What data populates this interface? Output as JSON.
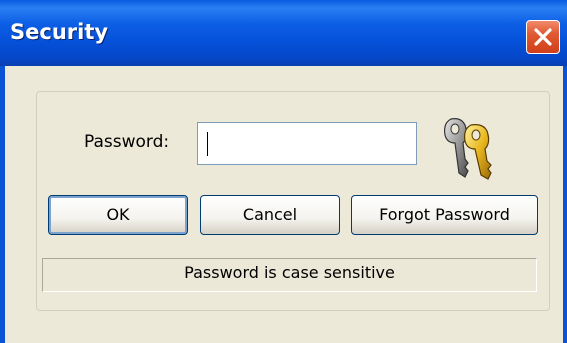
{
  "window": {
    "title": "Security",
    "close_icon": "close-icon"
  },
  "form": {
    "password_label": "Password:",
    "password_value": "",
    "keys_icon": "keys-icon"
  },
  "buttons": {
    "ok_label": "OK",
    "cancel_label": "Cancel",
    "forgot_label": "Forgot Password"
  },
  "status": {
    "text": "Password is case sensitive"
  },
  "colors": {
    "titlebar": "#0550d8",
    "close_button": "#e05a32",
    "dialog_background": "#ece9d8",
    "default_button_focus": "#7da2ce"
  }
}
